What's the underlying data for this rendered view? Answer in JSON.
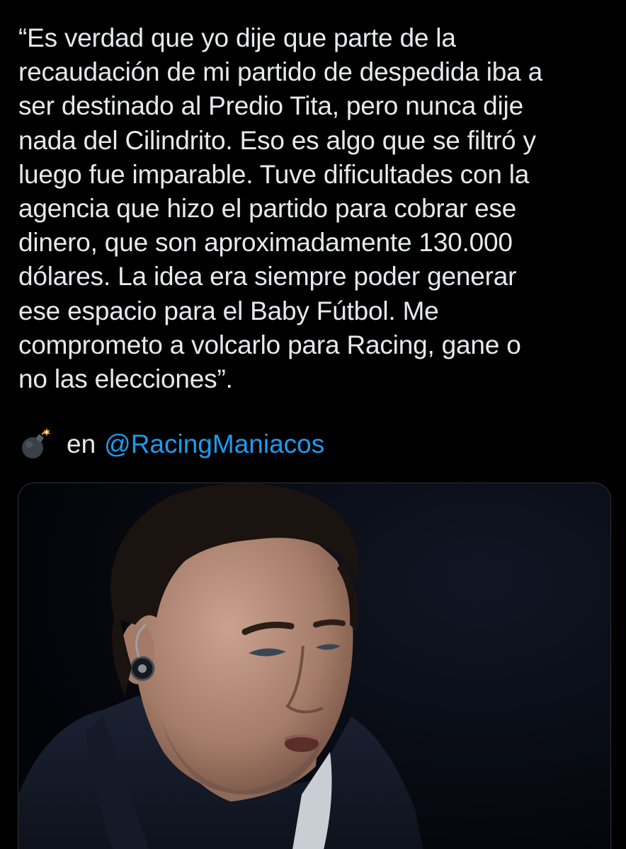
{
  "tweet": {
    "text": "“Es verdad que yo dije que parte de la\nrecaudación de mi partido de despedida iba a\nser destinado al Predio Tita, pero nunca dije\nnada del Cilindrito. Eso es algo que se filtró y\nluego fue imparable. Tuve dificultades con la\nagencia que hizo el partido para cobrar ese\ndinero, que son aproximadamente 130.000\ndólares. La idea era siempre poder generar\nese espacio para el Baby Fútbol. Me\ncomprometo a volcarlo para Racing, gane o\nno las elecciones”.",
    "credit": {
      "icon": "bomb-icon",
      "prefix": "en",
      "mention": "@RacingManiacos"
    },
    "media": {
      "alt": "photo-of-man-with-in-ear-monitor"
    }
  },
  "colors": {
    "background": "#000000",
    "text": "#e7e9ea",
    "link": "#1d9bf0",
    "card_border": "#2f3336"
  }
}
